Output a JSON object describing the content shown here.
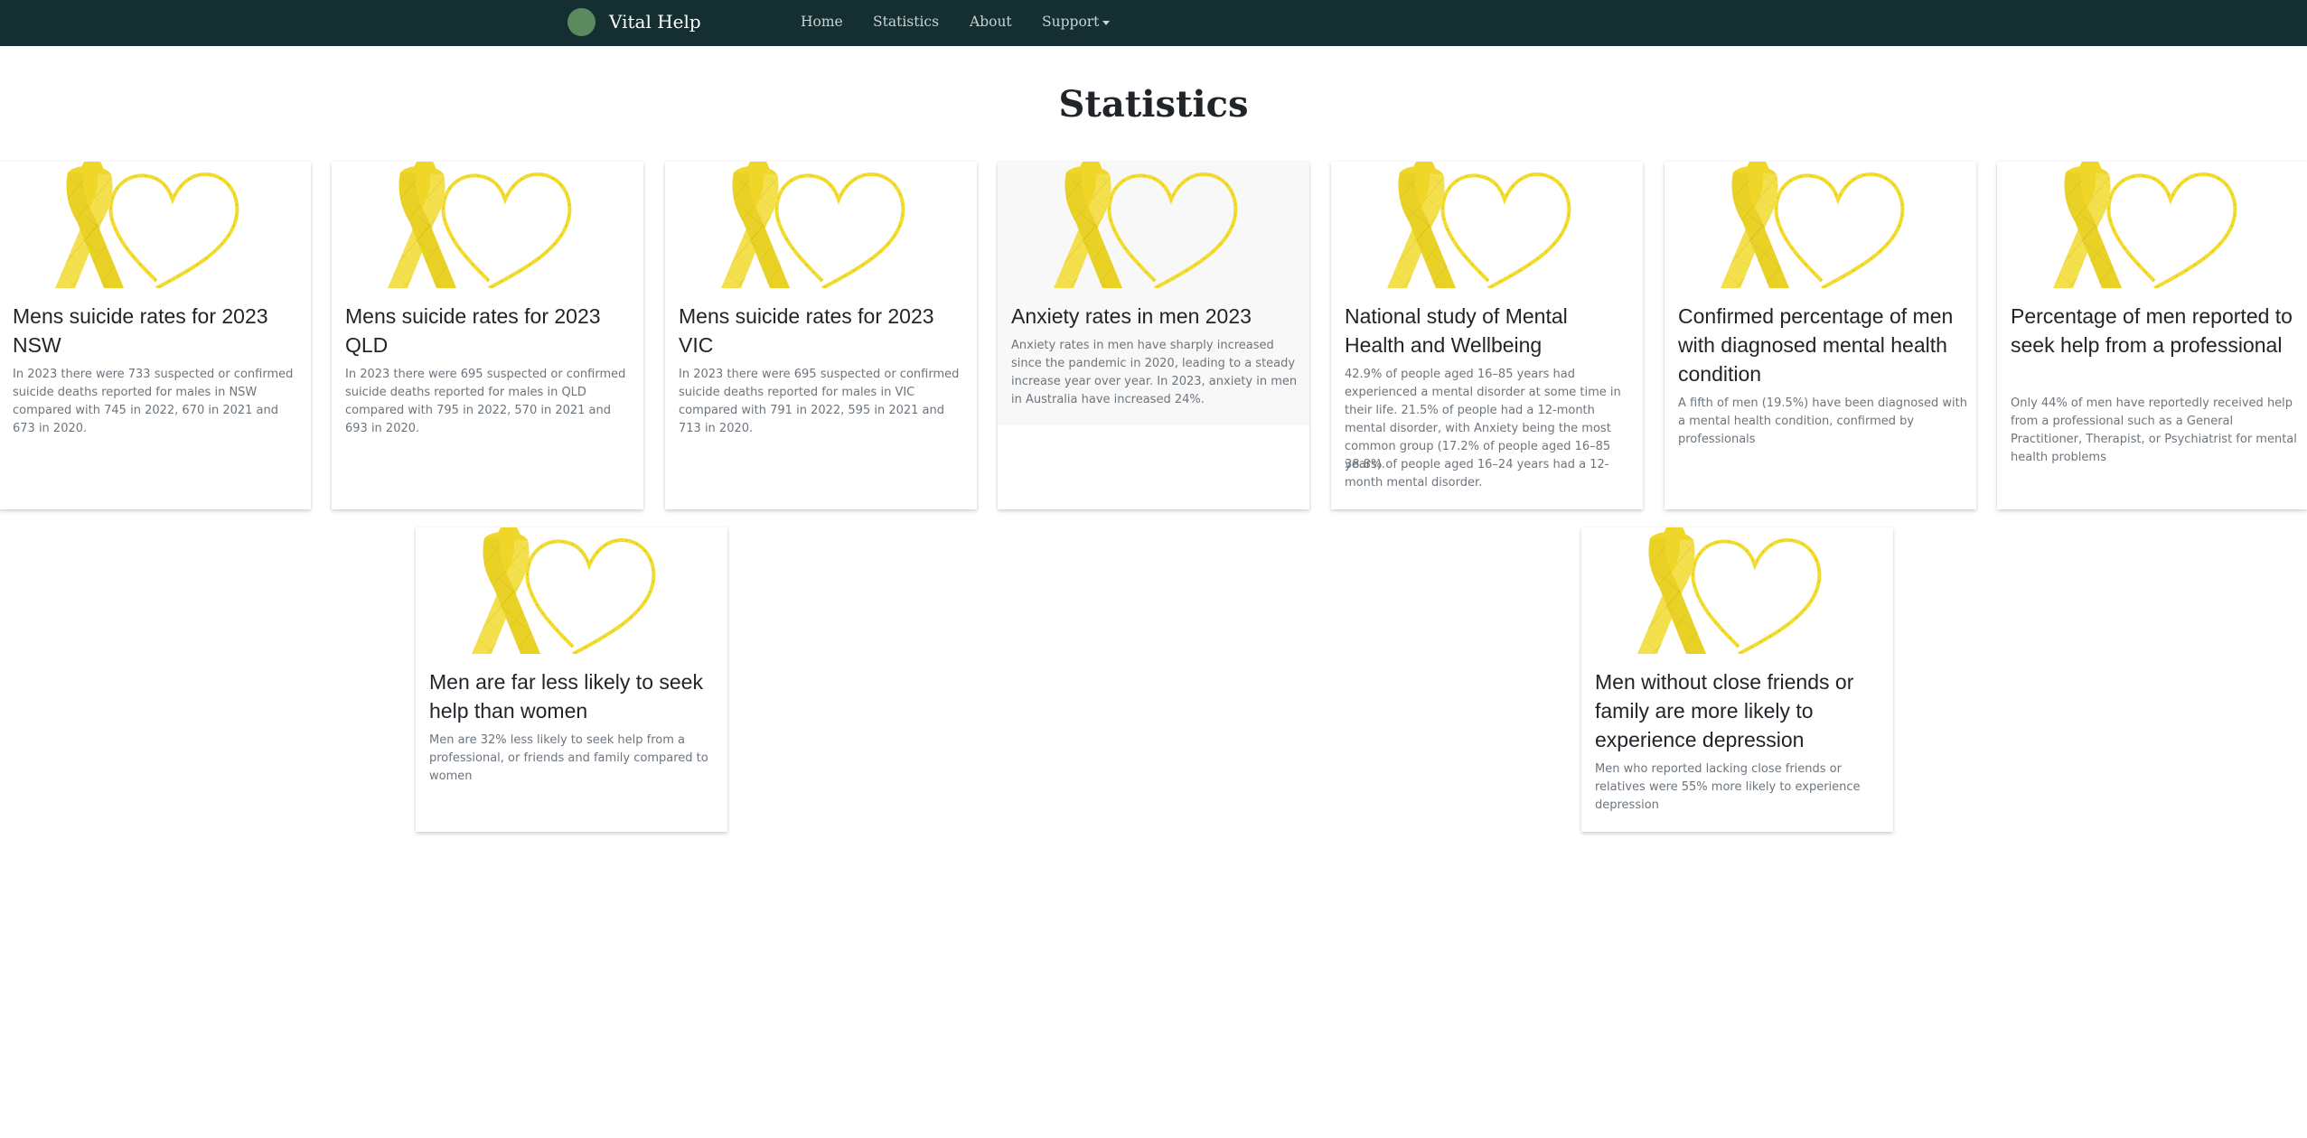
{
  "nav": {
    "brand": "Vital Help",
    "links": [
      "Home",
      "Statistics",
      "About",
      "Support"
    ]
  },
  "page": {
    "title": "Statistics"
  },
  "cards": [
    {
      "title": "Mens suicide rates for 2023 NSW",
      "text": "In 2023 there were 733 suspected or confirmed suicide deaths reported for males in NSW compared with 745 in 2022, 670 in 2021 and 673 in 2020."
    },
    {
      "title": "Mens suicide rates for 2023 QLD",
      "text": "In 2023 there were 695 suspected or confirmed suicide deaths reported for males in QLD compared with 795 in 2022, 570 in 2021 and 693 in 2020."
    },
    {
      "title": "Mens suicide rates for 2023 VIC",
      "text": "In 2023 there were 695 suspected or confirmed suicide deaths reported for males in VIC compared with 791 in 2022, 595 in 2021 and 713 in 2020."
    },
    {
      "title": "Anxiety rates in men 2023",
      "text": "Anxiety rates in men have sharply increased since the pandemic in 2020, leading to a steady increase year over year. In 2023, anxiety in men in Australia have increased 24%."
    },
    {
      "title": "National study of Mental Health and Wellbeing",
      "text": "42.9% of people aged 16–85 years had experienced a mental disorder at some time in their life. 21.5% of people had a 12-month mental disorder, with Anxiety being the most common group (17.2% of people aged 16–85 years).",
      "text2": "38.8% of people aged 16–24 years had a 12-month mental disorder."
    },
    {
      "title": "Confirmed percentage of men with diagnosed mental health condition",
      "text": "A fifth of men (19.5%) have been diagnosed with a mental health condition, confirmed by professionals"
    },
    {
      "title": "Percentage of men reported to seek help from a professional",
      "text": "Only 44% of men have reportedly received help from a professional such as a General Practitioner, Therapist, or Psychiatrist for mental health problems"
    },
    {
      "title": "Men are far less likely to seek help than women",
      "text": "Men are 32% less likely to seek help from a professional, or friends and family compared to women"
    },
    {
      "title": "Men without close friends or family are more likely to experience depression",
      "text": "Men who reported lacking close friends or relatives were 55% more likely to experience depression"
    }
  ],
  "colors": {
    "navbar": "#152e31",
    "ribbon": "#f4e04d",
    "ribbon_dark": "#e6cf2b",
    "heart": "#f1dc2f"
  },
  "icons": {
    "card_image": "yellow-ribbon-heart-icon",
    "brand_logo": "green-circle-logo-icon"
  }
}
